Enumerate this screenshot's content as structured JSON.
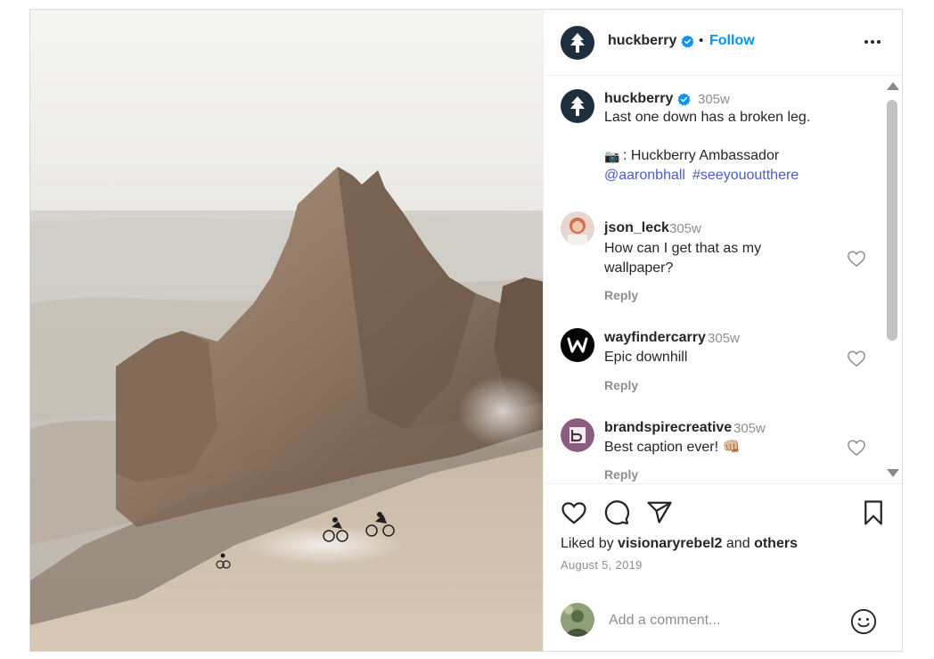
{
  "header": {
    "username": "huckberry",
    "separator": "•",
    "follow_label": "Follow",
    "more_icon": "more-horizontal-icon"
  },
  "caption": {
    "username": "huckberry",
    "time": "305w",
    "line1": "Last one down has a broken leg.",
    "camera_emoji": "📷",
    "credit": ": Huckberry Ambassador",
    "mention": "@aaronbhall",
    "hashtag": "#seeyououtthere"
  },
  "comments": [
    {
      "username": "json_leck",
      "time": "305w",
      "text_line1": "How can I get that as my",
      "text_line2": "wallpaper?",
      "reply_label": "Reply"
    },
    {
      "username": "wayfindercarry",
      "time": "305w",
      "text_line1": "Epic downhill",
      "reply_label": "Reply"
    },
    {
      "username": "brandspirecreative",
      "time": "305w",
      "text_line1": "Best caption ever! 👊🏼",
      "reply_label": "Reply"
    }
  ],
  "likes": {
    "prefix": "Liked by",
    "user": "visionaryrebel2",
    "joiner": "and",
    "others": "others"
  },
  "date": "August 5, 2019",
  "add_comment": {
    "placeholder": "Add a comment..."
  },
  "colors": {
    "link": "#4a5bcf",
    "follow": "#0095f6",
    "verified": "#0095f6",
    "muted": "#8e8e8e"
  }
}
